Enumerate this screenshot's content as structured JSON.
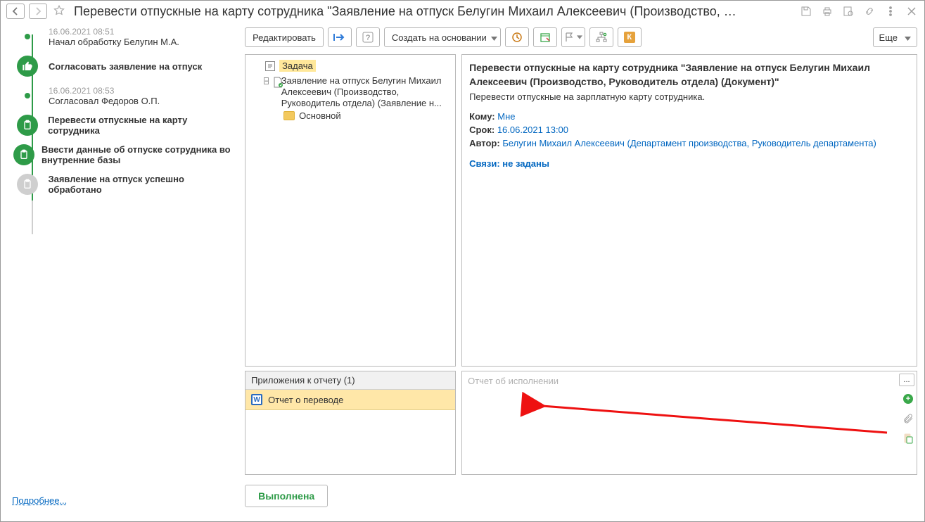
{
  "header": {
    "title": "Перевести отпускные на карту сотрудника \"Заявление на отпуск Белугин Михаил Алексеевич (Производство, …"
  },
  "timeline": {
    "items": [
      {
        "kind": "dot",
        "time": "16.06.2021 08:51",
        "text": "Начал обработку Белугин М.А."
      },
      {
        "kind": "green",
        "icon": "thumb",
        "text": "Согласовать заявление на отпуск",
        "bold": true
      },
      {
        "kind": "dot",
        "time": "16.06.2021 08:53",
        "text": "Согласовал Федоров О.П."
      },
      {
        "kind": "green",
        "icon": "clip",
        "text": "Перевести отпускные на карту сотрудника",
        "bold": true
      },
      {
        "kind": "green",
        "icon": "clip",
        "text": "Ввести данные об отпуске сотрудника во внутренние базы",
        "bold": true
      },
      {
        "kind": "gray",
        "icon": "clip",
        "text": "Заявление на отпуск успешно обработано",
        "bold": true
      }
    ],
    "more_link": "Подробнее..."
  },
  "toolbar": {
    "edit": "Редактировать",
    "create_based": "Создать на основании",
    "more": "Еще"
  },
  "tree": {
    "root_label": "Задача",
    "doc_label": "Заявление на отпуск Белугин Михаил Алексеевич (Производство, Руководитель отдела) (Заявление н...",
    "folder_label": "Основной"
  },
  "details": {
    "title": "Перевести отпускные на карту сотрудника \"Заявление на отпуск Белугин Михаил Алексеевич (Производство, Руководитель отдела) (Документ)\"",
    "description": "Перевести отпускные на зарплатную карту сотрудника.",
    "to_label": "Кому:",
    "to_value": "Мне",
    "deadline_label": "Срок:",
    "deadline_value": "16.06.2021 13:00",
    "author_label": "Автор:",
    "author_value": "Белугин Михаил Алексеевич (Департамент производства, Руководитель департамента)",
    "relations": "Связи: не заданы"
  },
  "attachments": {
    "header": "Приложения к отчету (1)",
    "item": "Отчет о переводе"
  },
  "report": {
    "placeholder": "Отчет об исполнении",
    "ellipsis": "..."
  },
  "footer": {
    "done": "Выполнена"
  }
}
